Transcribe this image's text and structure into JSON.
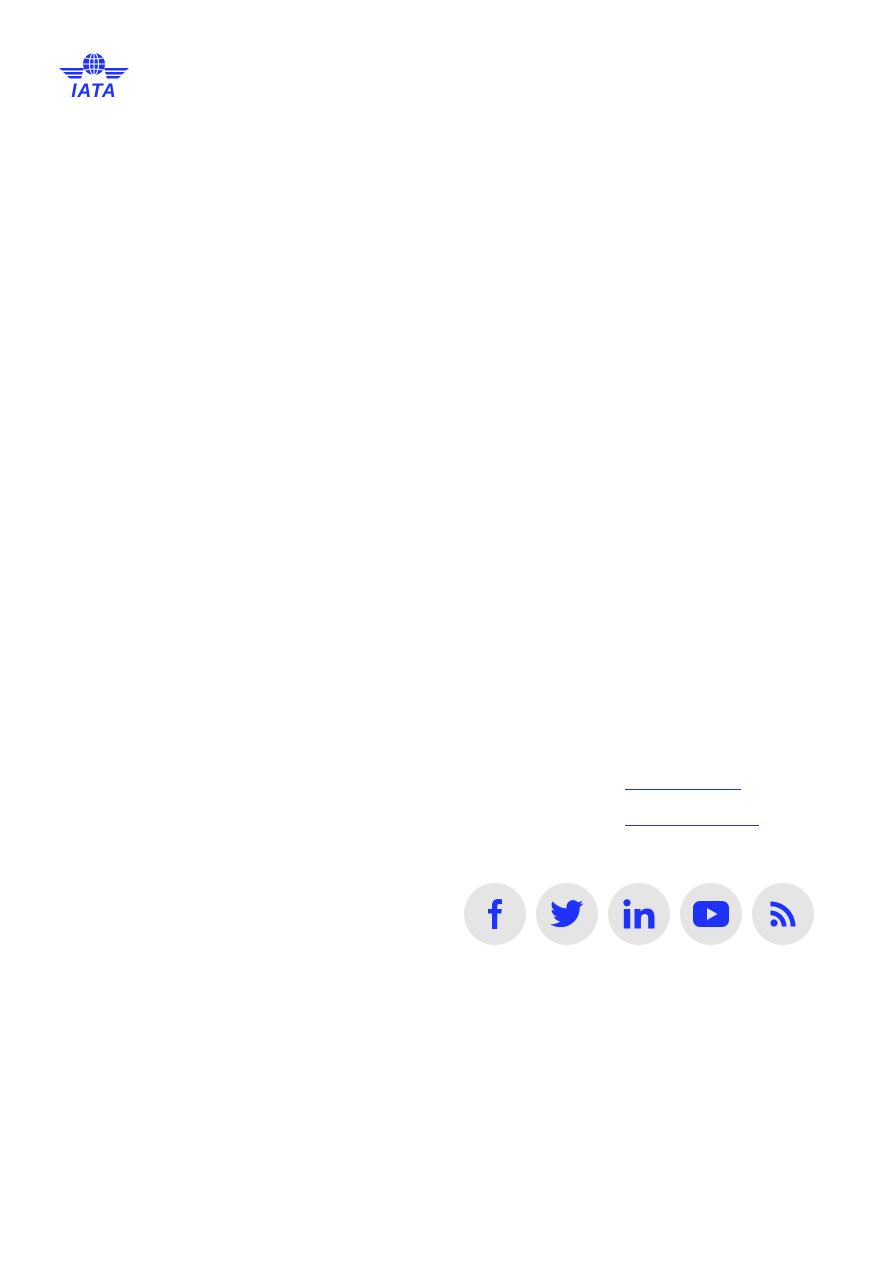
{
  "brand": {
    "logo_text": "IATA",
    "logo_icon": "iata-globe-wings-logo",
    "color": "#1e32fa"
  },
  "links": [
    {
      "name": "link-1",
      "text": ""
    },
    {
      "name": "link-2",
      "text": ""
    }
  ],
  "social": {
    "button_bg": "#e5e5e5",
    "icon_color": "#1e32fa",
    "items": [
      {
        "icon": "facebook-icon"
      },
      {
        "icon": "twitter-icon"
      },
      {
        "icon": "linkedin-icon"
      },
      {
        "icon": "youtube-icon"
      },
      {
        "icon": "rss-icon"
      }
    ]
  }
}
